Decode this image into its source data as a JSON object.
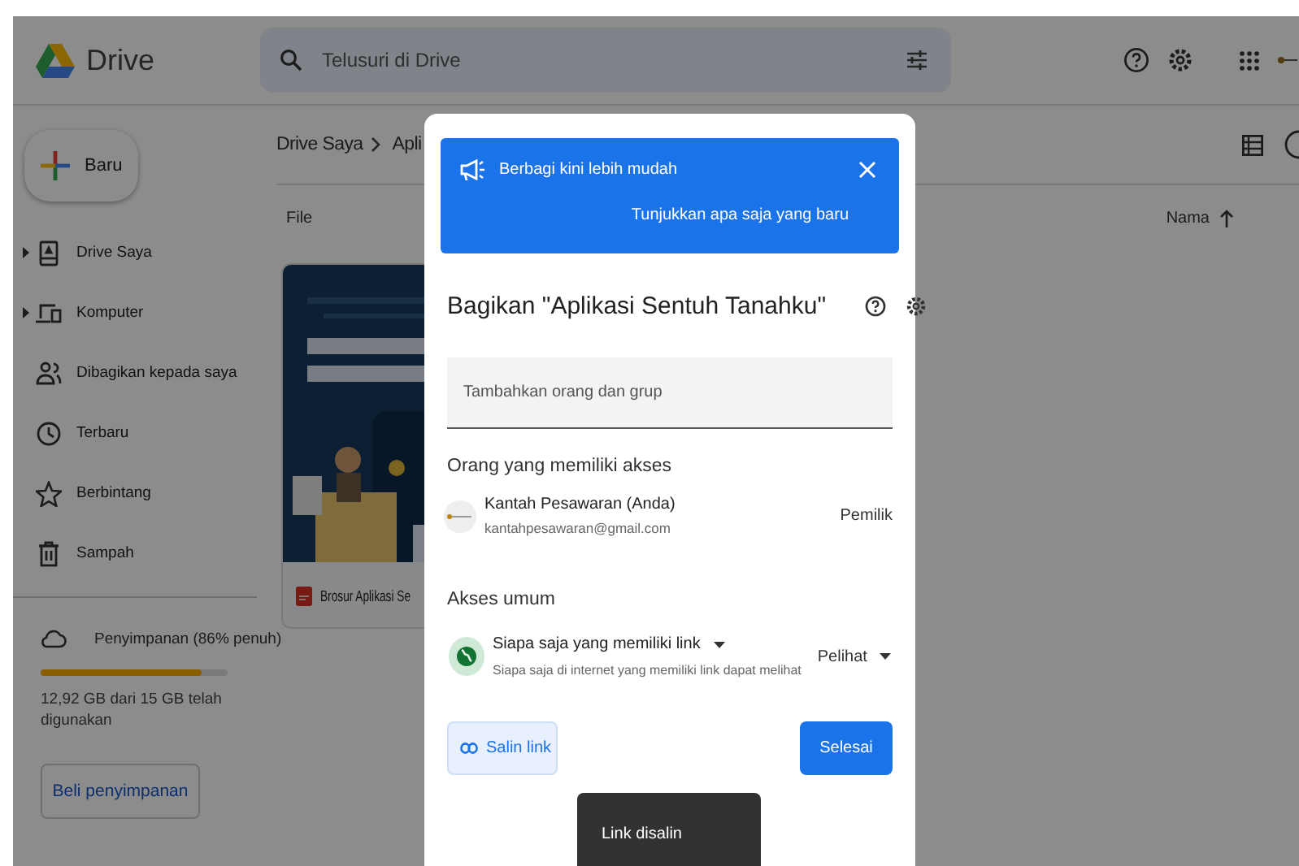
{
  "app": {
    "name": "Drive"
  },
  "search": {
    "placeholder": "Telusuri di Drive"
  },
  "new_button": {
    "label": "Baru"
  },
  "sidebar": {
    "items": [
      {
        "label": "Drive Saya",
        "kind": "drive",
        "expandable": true,
        "selected": false
      },
      {
        "label": "Komputer",
        "kind": "computer",
        "expandable": true,
        "selected": false
      },
      {
        "label": "Dibagikan kepada saya",
        "kind": "shared",
        "expandable": false,
        "selected": false
      },
      {
        "label": "Terbaru",
        "kind": "recent",
        "expandable": false,
        "selected": false
      },
      {
        "label": "Berbintang",
        "kind": "starred",
        "expandable": false,
        "selected": false
      },
      {
        "label": "Sampah",
        "kind": "trash",
        "expandable": false,
        "selected": false
      }
    ]
  },
  "storage": {
    "label": "Penyimpanan (86% penuh)",
    "level": 0.86,
    "usage": "12,92 GB dari 15 GB telah digunakan",
    "buy_button": "Beli penyimpanan"
  },
  "breadcrumb": [
    "Drive Saya",
    "Apli"
  ],
  "files": {
    "section_label": "File",
    "sort_label": "Nama",
    "items": [
      {
        "name": "Brosur Aplikasi Se"
      }
    ]
  },
  "share_dialog": {
    "banner": {
      "title": "Berbagi kini lebih mudah",
      "link": "Tunjukkan apa saja yang baru"
    },
    "title": "Bagikan \"Aplikasi Sentuh Tanahku\"",
    "input_placeholder": "Tambahkan orang dan grup",
    "people_heading": "Orang yang memiliki akses",
    "people": [
      {
        "name": "Kantah Pesawaran (Anda)",
        "email": "kantahpesawaran@gmail.com",
        "role": "Pemilik"
      }
    ],
    "general_heading": "Akses umum",
    "general_access": {
      "scope": "Siapa saja yang memiliki link",
      "description": "Siapa saja di internet yang memiliki link dapat melihat",
      "role": "Pelihat"
    },
    "copy_button": "Salin link",
    "done_button": "Selesai"
  },
  "toast": {
    "message": "Link disalin"
  }
}
